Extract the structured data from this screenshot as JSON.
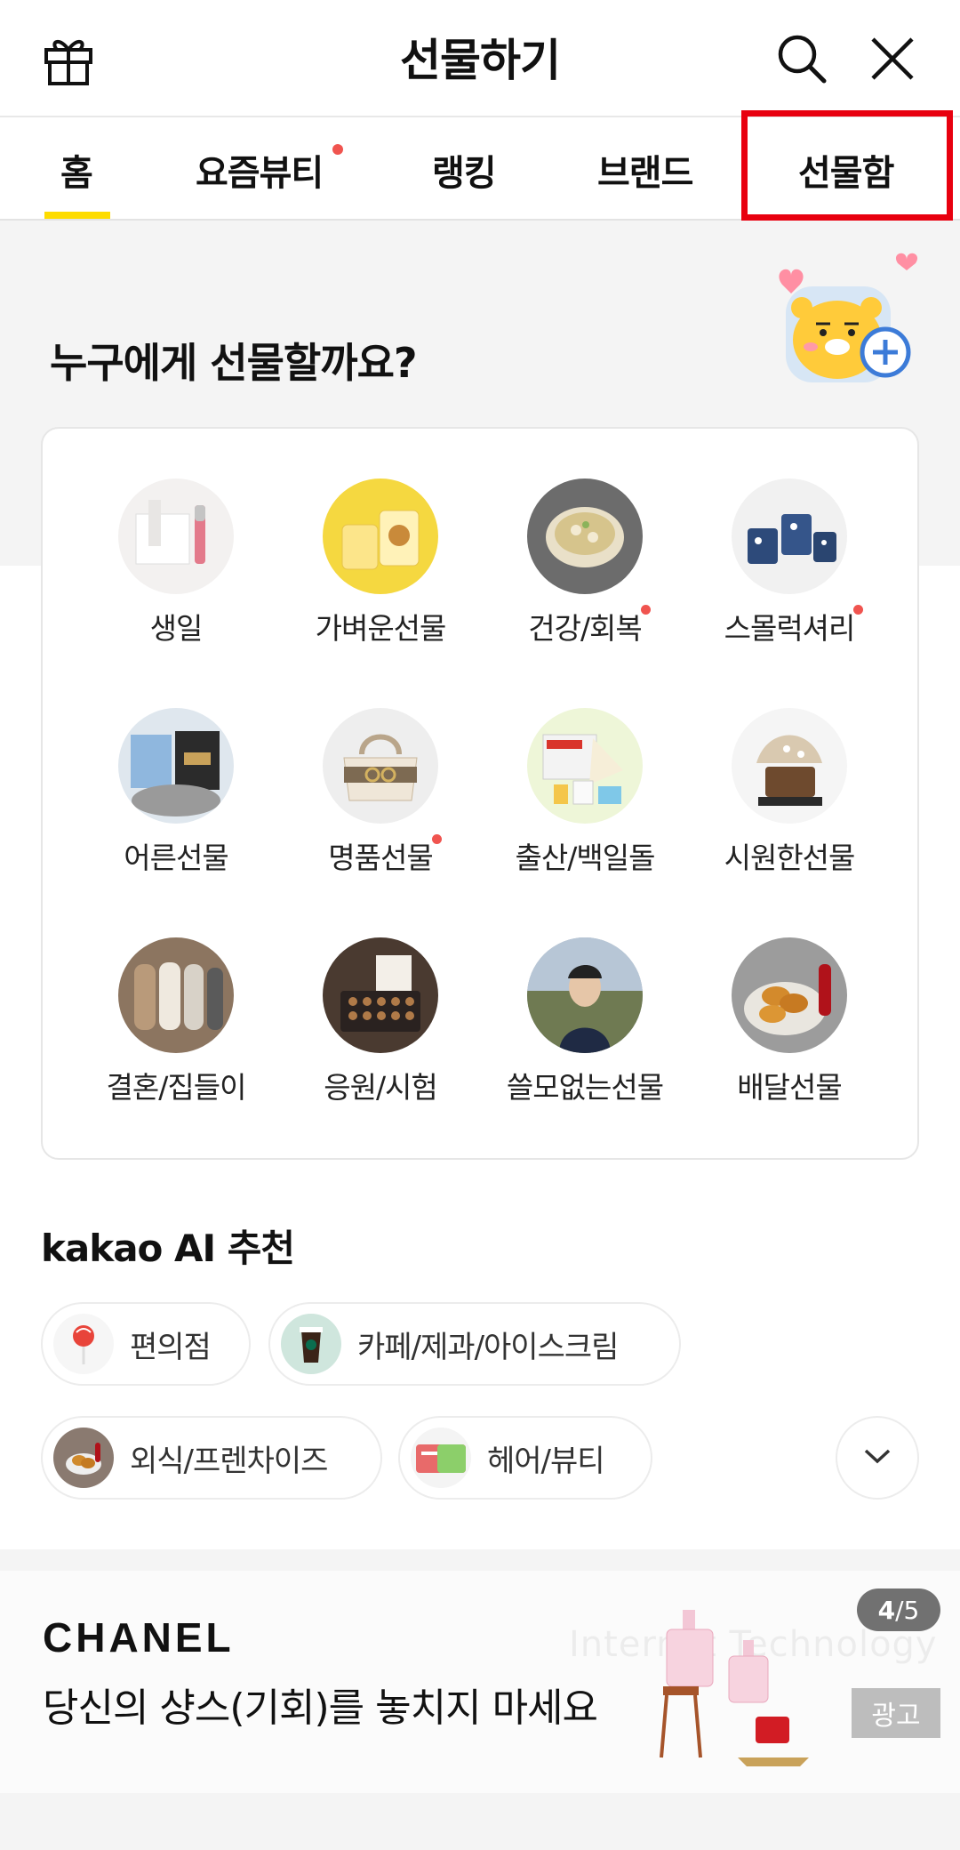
{
  "header": {
    "title": "선물하기",
    "left_icon": "gift-icon",
    "right_icons": [
      "search-icon",
      "close-icon"
    ]
  },
  "tabs": [
    {
      "label": "홈",
      "active": true,
      "new_dot": false
    },
    {
      "label": "요즘뷰티",
      "active": false,
      "new_dot": true
    },
    {
      "label": "랭킹",
      "active": false,
      "new_dot": false
    },
    {
      "label": "브랜드",
      "active": false,
      "new_dot": false
    },
    {
      "label": "선물함",
      "active": false,
      "new_dot": false,
      "highlighted": true
    }
  ],
  "main": {
    "headline": "누구에게 선물할까요?",
    "categories": [
      {
        "label": "생일",
        "dot": false
      },
      {
        "label": "가벼운선물",
        "dot": false
      },
      {
        "label": "건강/회복",
        "dot": true
      },
      {
        "label": "스몰럭셔리",
        "dot": true
      },
      {
        "label": "어른선물",
        "dot": false
      },
      {
        "label": "명품선물",
        "dot": true
      },
      {
        "label": "출산/백일돌",
        "dot": false
      },
      {
        "label": "시원한선물",
        "dot": false
      },
      {
        "label": "결혼/집들이",
        "dot": false
      },
      {
        "label": "응원/시험",
        "dot": false
      },
      {
        "label": "쓸모없는선물",
        "dot": false
      },
      {
        "label": "배달선물",
        "dot": false
      }
    ]
  },
  "ai_section": {
    "brand": "kakao AI",
    "suffix": " 추천",
    "chips": [
      {
        "label": "편의점",
        "icon": "lollipop-icon"
      },
      {
        "label": "카페/제과/아이스크림",
        "icon": "coffee-cup-icon"
      },
      {
        "label": "외식/프렌차이즈",
        "icon": "food-icon"
      },
      {
        "label": "헤어/뷰티",
        "icon": "gift-card-icon"
      }
    ],
    "expand_icon": "chevron-down-icon"
  },
  "banner": {
    "brand": "CHANEL",
    "copy": "당신의 샹스(기회)를 놓치지 마세요",
    "counter_current": "4",
    "counter_total": "/5",
    "ad_label": "광고",
    "watermark": "Internet Technology"
  },
  "colors": {
    "accent_yellow": "#fedc00",
    "dot_red": "#f0544f",
    "highlight_red": "#e8000f",
    "background_grey": "#f4f4f4"
  }
}
